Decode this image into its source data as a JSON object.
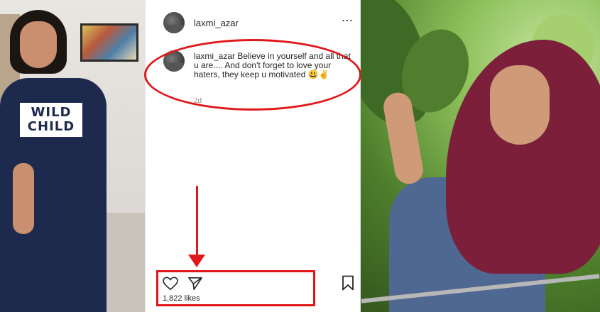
{
  "post": {
    "username": "laxmi_azar",
    "more_icon": "⋯",
    "caption_user": "laxmi_azar",
    "caption_text": "Believe in yourself and all that u are.... And don't forget to love your haters, they keep u motivated 😃✌",
    "time": "2d",
    "likes": "1,822 likes"
  },
  "left_photo": {
    "shirt_text": "WILD CHILD"
  },
  "icons": {
    "heart": "heart-icon",
    "send": "send-icon",
    "bookmark": "bookmark-icon",
    "more": "more-options-icon"
  },
  "colors": {
    "annotation_red": "#e0181b",
    "text": "#262626",
    "muted": "#8e8e8e"
  }
}
